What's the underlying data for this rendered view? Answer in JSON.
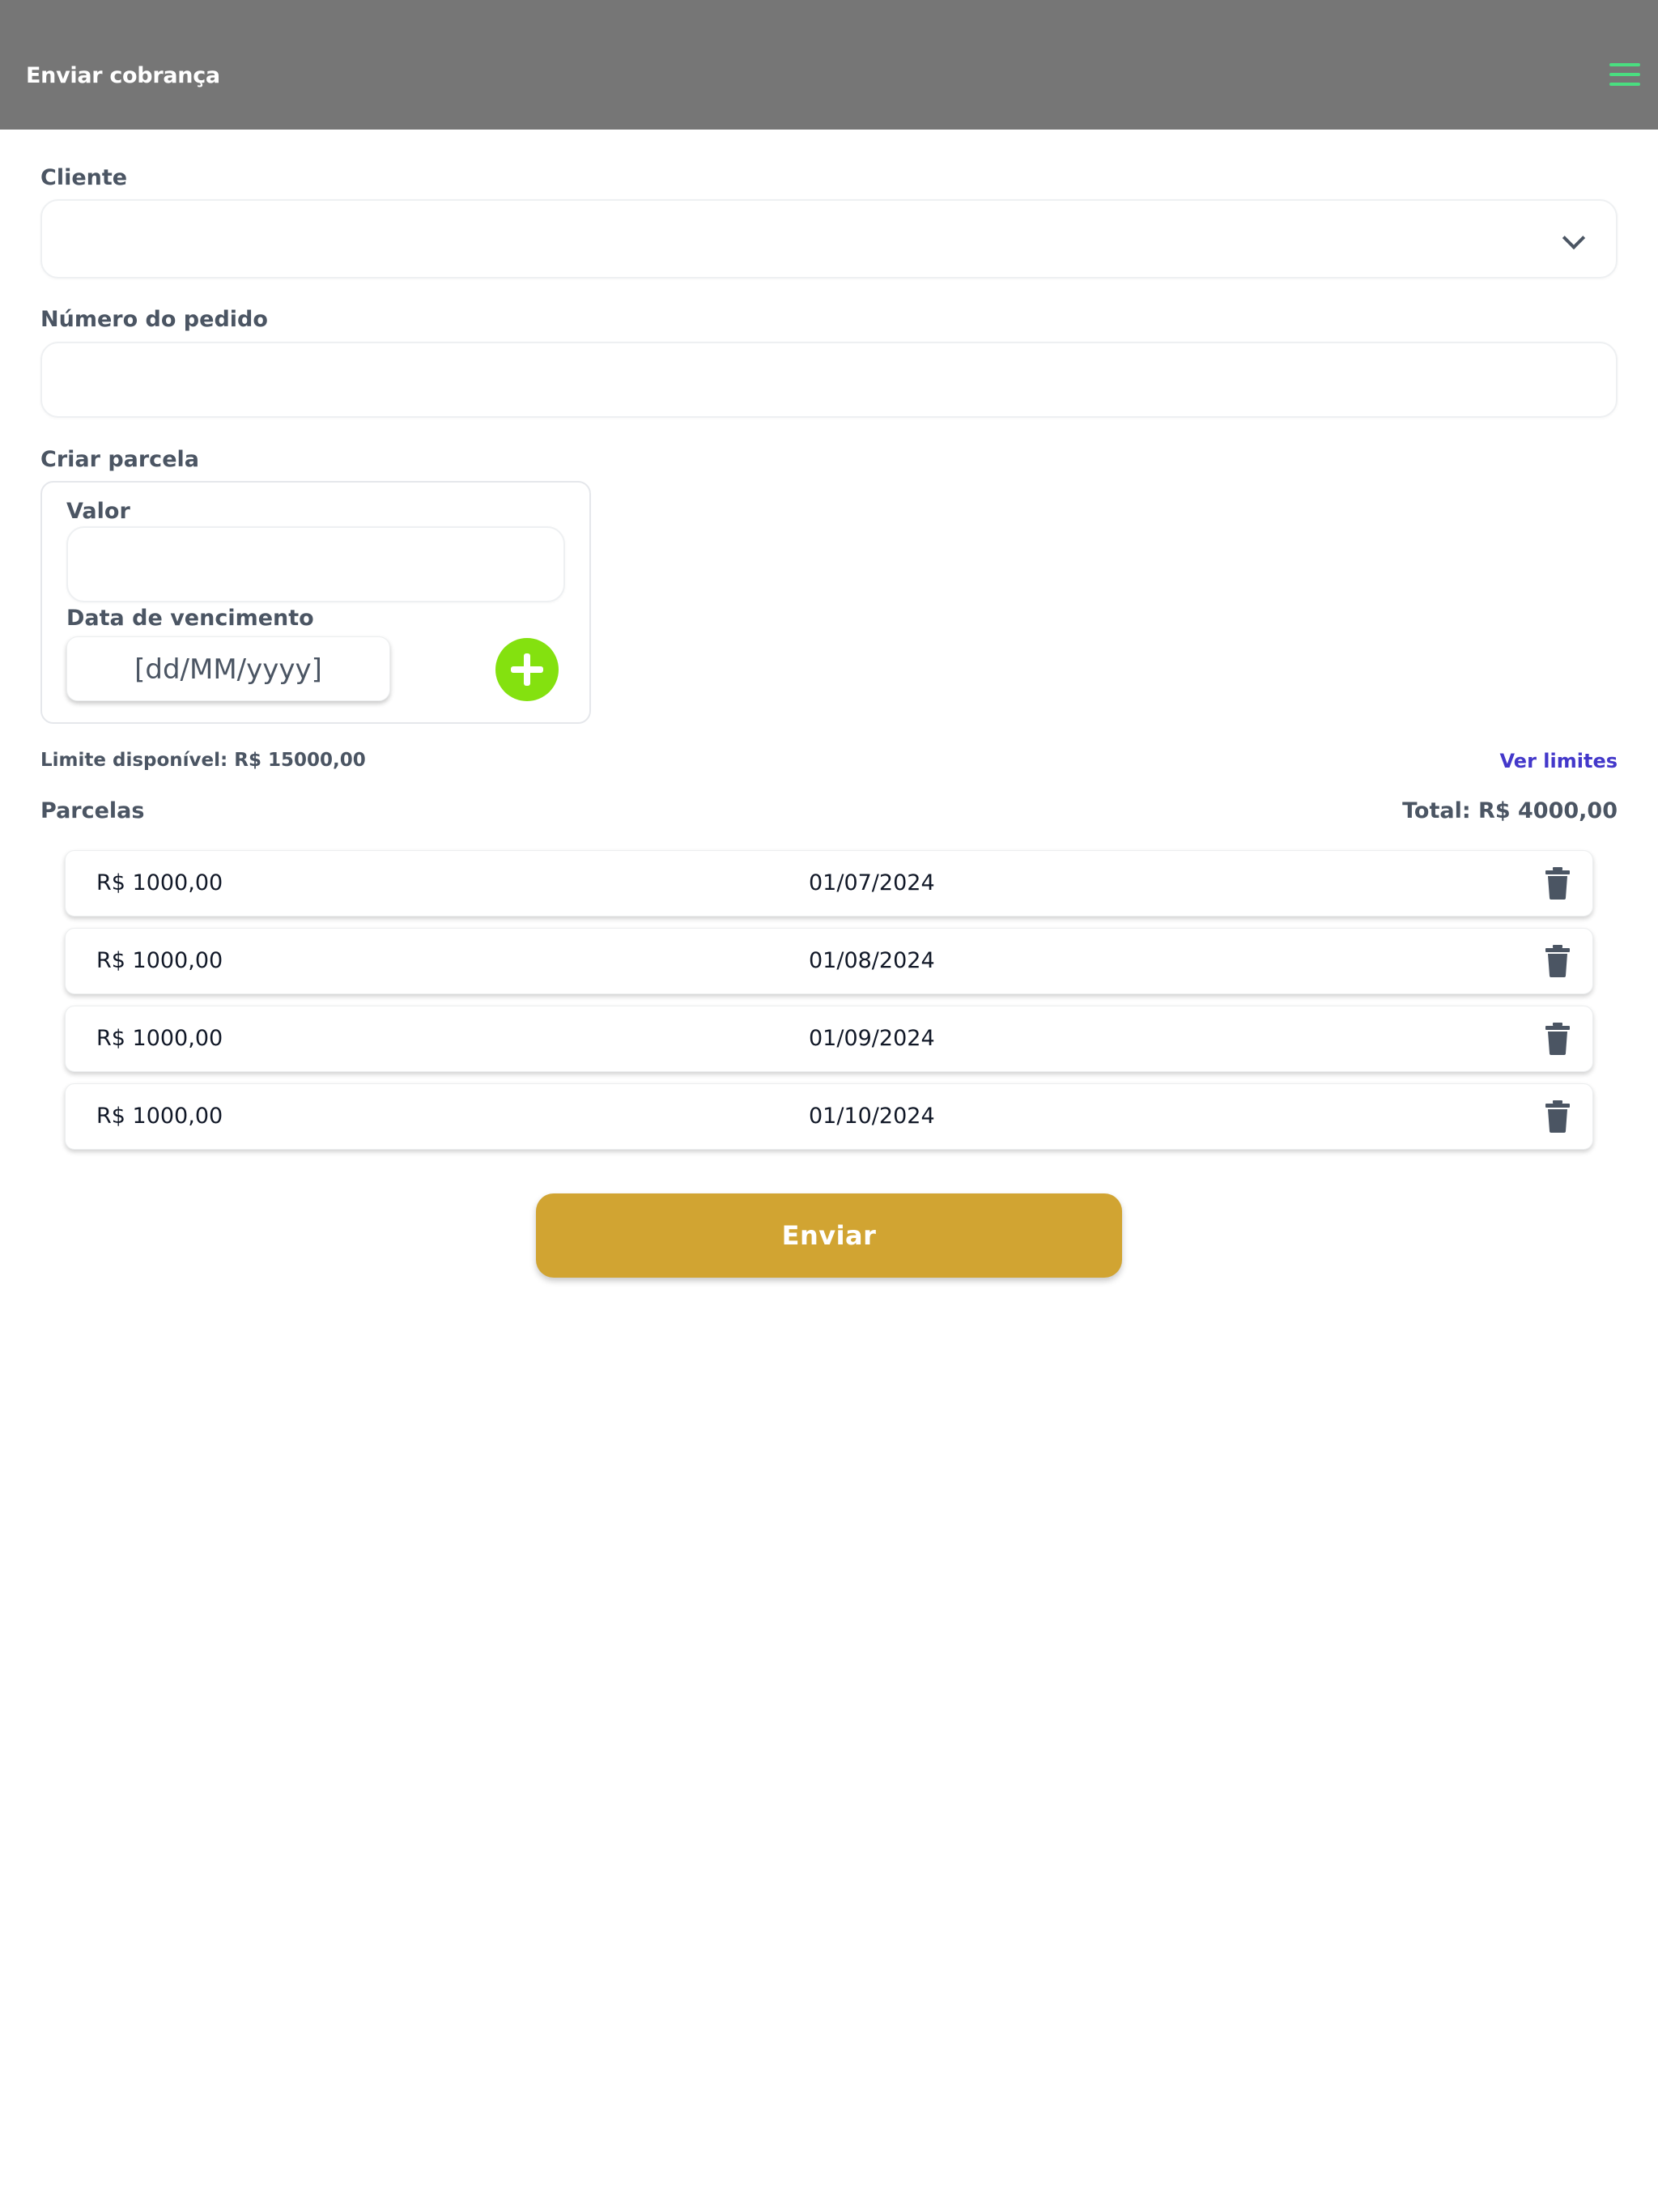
{
  "header": {
    "title": "Enviar cobrança",
    "menu_icon": "hamburger-menu-icon",
    "menu_icon_color": "#4ade80",
    "background_color": "#767676"
  },
  "form": {
    "client": {
      "label": "Cliente",
      "value": "",
      "icon": "chevron-down-icon"
    },
    "order_number": {
      "label": "Número do pedido",
      "value": ""
    },
    "create_installment": {
      "label": "Criar parcela",
      "amount_label": "Valor",
      "amount_value": "",
      "due_date_label": "Data de vencimento",
      "due_date_placeholder": "[dd/MM/yyyy]",
      "add_icon": "plus-circle-icon",
      "add_color": "#84e10f"
    },
    "available_limit": "Limite disponível: R$ 15000,00",
    "view_limits_link": "Ver limites"
  },
  "installments": {
    "label": "Parcelas",
    "total": "Total: R$ 4000,00",
    "delete_icon": "trash-icon",
    "items": [
      {
        "amount": "R$ 1000,00",
        "due_date": "01/07/2024"
      },
      {
        "amount": "R$ 1000,00",
        "due_date": "01/08/2024"
      },
      {
        "amount": "R$ 1000,00",
        "due_date": "01/09/2024"
      },
      {
        "amount": "R$ 1000,00",
        "due_date": "01/10/2024"
      }
    ]
  },
  "submit": {
    "label": "Enviar",
    "color": "#d1a432"
  }
}
